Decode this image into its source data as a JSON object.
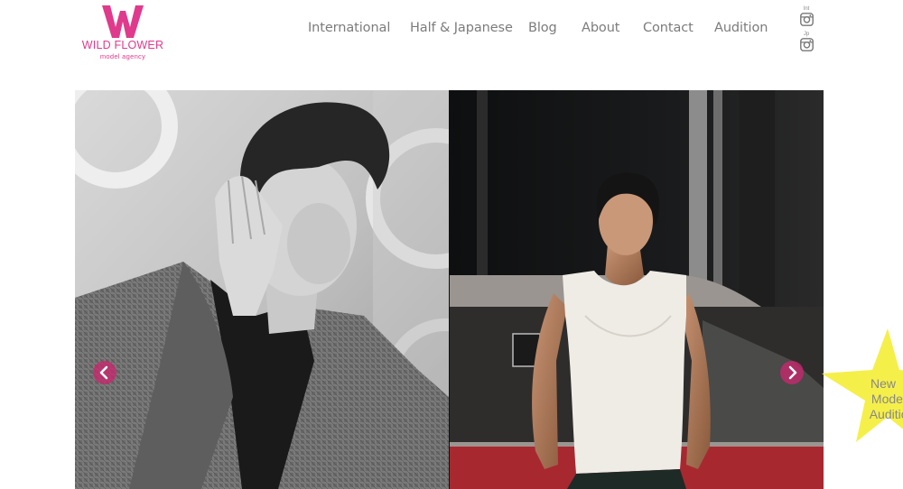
{
  "brand": {
    "logo_letter": "W",
    "name": "WILD FLOWER",
    "tagline": "model agency",
    "color": "#e03a8c"
  },
  "nav": {
    "items": [
      {
        "label": "International"
      },
      {
        "label": "Half & Japanese"
      },
      {
        "label": "Blog"
      },
      {
        "label": "About"
      },
      {
        "label": "Contact"
      },
      {
        "label": "Audition"
      }
    ]
  },
  "social": [
    {
      "tag": "Int",
      "icon": "instagram-icon"
    },
    {
      "tag": "Jp",
      "icon": "instagram-icon"
    }
  ],
  "slider": {
    "prev_icon": "chevron-left-icon",
    "next_icon": "chevron-right-icon",
    "arrow_color": "#c8286e",
    "slides": [
      {
        "description_icon": "model-photo-bw"
      },
      {
        "description_icon": "model-photo-color"
      }
    ]
  },
  "badge": {
    "lines": [
      "New",
      "Model",
      "Audition"
    ],
    "color": "#f5ef4a"
  }
}
